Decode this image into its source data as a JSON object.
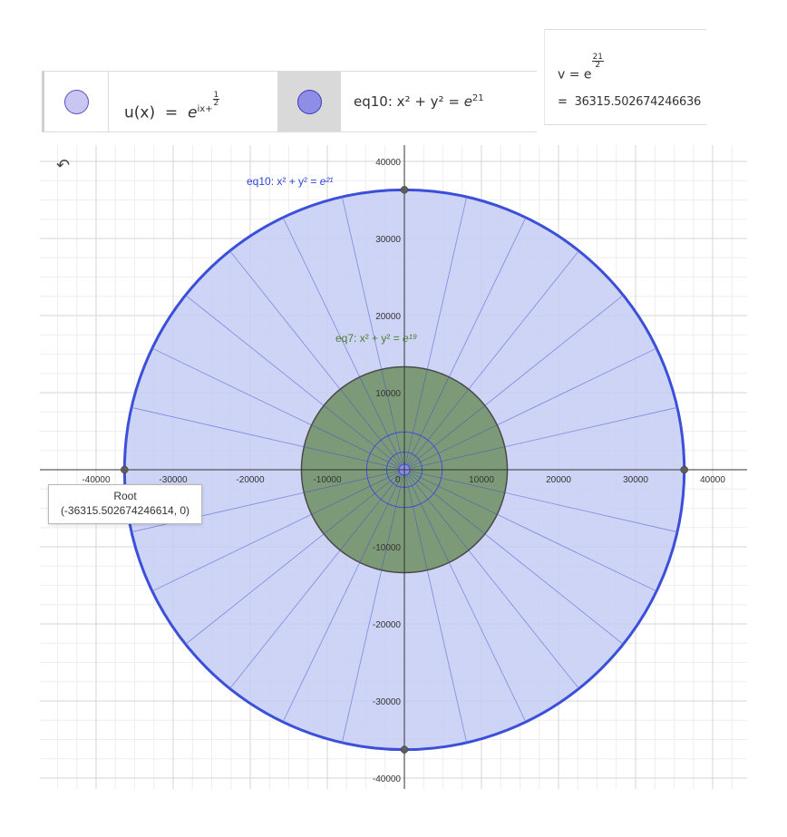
{
  "algebra": {
    "u": {
      "lhs": "u(x)",
      "eq": "=",
      "base": "e",
      "exp": "ix+",
      "frac_num": "1",
      "frac_den": "2",
      "color": "#c9c6f2"
    },
    "eq10": {
      "label": "eq10:",
      "expr": "x² + y² =",
      "base": "e",
      "exp": "21",
      "color": "#8e8ee6"
    },
    "v": {
      "lhs": "v =",
      "base": "e",
      "frac_num": "21",
      "frac_den": "2",
      "equals": "=",
      "value": "36315.502674246636"
    }
  },
  "graph": {
    "x_ticks": [
      "-40000",
      "-30000",
      "-20000",
      "-10000",
      "0",
      "10000",
      "20000",
      "30000",
      "40000"
    ],
    "y_ticks": [
      "40000",
      "30000",
      "20000",
      "10000",
      "-10000",
      "-20000",
      "-30000",
      "-40000"
    ],
    "big_circle": {
      "label": "eq10: x² + y² = ",
      "label_exp": "e²¹",
      "radius": 36315.5,
      "color": "#3b4fd8",
      "fill": "#c5cdf3"
    },
    "mid_circle": {
      "label": "eq7: x² + y² = ",
      "label_exp": "e¹⁹",
      "radius": 13360,
      "color": "#4a4a4a",
      "fill": "#6e8f62"
    },
    "root": {
      "title": "Root",
      "coords": "(-36315.502674246614, 0)"
    },
    "undo_icon": "undo-icon"
  }
}
